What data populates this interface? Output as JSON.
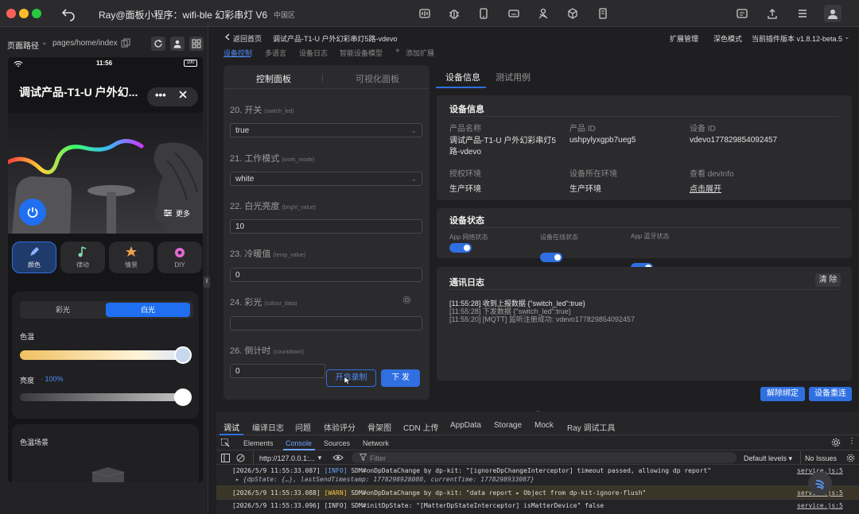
{
  "titlebar": {
    "title": "Ray@面板小程序：wifi-ble 幻彩串灯 V6",
    "region": "中国区"
  },
  "left": {
    "path_label": "页面路径",
    "path_value": "pages/home/index",
    "phone": {
      "time": "11:56",
      "battery": "100",
      "title": "调试产品-T1-U 户外幻...",
      "more_btn": "更多",
      "modes": [
        "颜色",
        "律动",
        "情景",
        "DIY"
      ],
      "tab_color": "彩光",
      "tab_white": "白光",
      "temp_label": "色温",
      "bright_label": "亮度",
      "bright_value": "· 100%",
      "scene_label": "色温场景"
    }
  },
  "middle": {
    "top_nav": [
      "返回首页",
      "调试产品-T1-U 户外幻彩串灯5路-vdevo"
    ],
    "sub_nav": [
      "设备控制",
      "多语言",
      "设备日志",
      "智能设备模型",
      "添加扩展"
    ],
    "tabs": [
      "控制面板",
      "可视化面板"
    ],
    "fields": [
      {
        "label": "20. 开关",
        "code": "(switch_led)",
        "value": "true"
      },
      {
        "label": "21. 工作模式",
        "code": "(work_mode)",
        "value": "white"
      },
      {
        "label": "22. 白光亮度",
        "code": "(bright_value)",
        "value": "10"
      },
      {
        "label": "23. 冷暖值",
        "code": "(temp_value)",
        "value": "0"
      },
      {
        "label": "24. 彩光",
        "code": "(colour_data)",
        "value": ""
      },
      {
        "label": "26. 倒计时",
        "code": "(countdown)",
        "value": "0"
      }
    ],
    "record_btn": "开启录制",
    "send_btn": "下 发"
  },
  "right": {
    "header_links": [
      "扩展管理",
      "深色模式",
      "当前插件版本 v1.8.12-beta.5"
    ],
    "tabs": [
      "设备信息",
      "测试用例"
    ],
    "info": {
      "title": "设备信息",
      "product_name_label": "产品名称",
      "product_name": "调试产品-T1-U 户外幻彩串灯5路-vdevo",
      "product_id_label": "产品 ID",
      "product_id": "ushpylyxgpb7ueg5",
      "device_id_label": "设备 ID",
      "device_id": "vdevo177829854092457",
      "auth_env_label": "授权环境",
      "auth_env": "生产环境",
      "device_env_label": "设备所在环境",
      "device_env": "生产环境",
      "devinfo_label": "查看 devInfo",
      "devinfo_link": "点击展开"
    },
    "status": {
      "title": "设备状态",
      "items": [
        "App 网络状态",
        "设备在线状态",
        "App 蓝牙状态"
      ]
    },
    "log": {
      "title": "通讯日志",
      "clear_btn": "清 除",
      "lines": [
        "[11:55:28] 收到上报数据 {\"switch_led\":true}",
        "[11:55:28] 下发数据 {\"switch_led\":true}",
        "[11:55:20] [MQTT] 监听注册成功: vdevo177829854092457"
      ]
    },
    "unbind_btn": "解除绑定",
    "reset_btn": "设备重连"
  },
  "devtools": {
    "top_tabs": [
      "调试",
      "编译日志",
      "问题",
      "体验评分",
      "骨架图",
      "CDN 上传",
      "AppData",
      "Storage",
      "Mock",
      "Ray 调试工具"
    ],
    "sub_tabs": [
      "Elements",
      "Console",
      "Sources",
      "Network"
    ],
    "context": "http://127.0.0.1:...",
    "filter_placeholder": "Filter",
    "levels": "Default levels ▾",
    "issues": "No Issues",
    "log_lines": [
      {
        "ts": "[2026/5/9 11:55:33.087]",
        "tag": "[INFO]",
        "msg": " SDM#onDpDataChange by dp-kit: \"[ignoreDpChangeInterceptor] timeout passed, allowing dp report\"",
        "src": "service.js:5"
      },
      {
        "ts": "",
        "tag": "",
        "msg": "▸ {dpState: {…}, lastSendTimestamp: 1778298928080, currentTime: 1778298933087}",
        "src": ""
      },
      {
        "ts": "[2026/5/9 11:55:33.088]",
        "tag": "[WARN]",
        "msg": " SDM#onDpDataChange by dp-kit: \"data report  ▸ Object  from dp-kit-ignore-flush\"",
        "src": "service.js:5"
      },
      {
        "ts": "[2026/5/9 11:55:33.096]",
        "tag": "[INFO]",
        "msg": " SDM#initDpState: \"[MatterDpStateInterceptor] isMatterDevice\" false",
        "src": "service.js:5"
      }
    ]
  },
  "colors": {
    "accent": "#2f6fe0",
    "link": "#4d8df5"
  }
}
